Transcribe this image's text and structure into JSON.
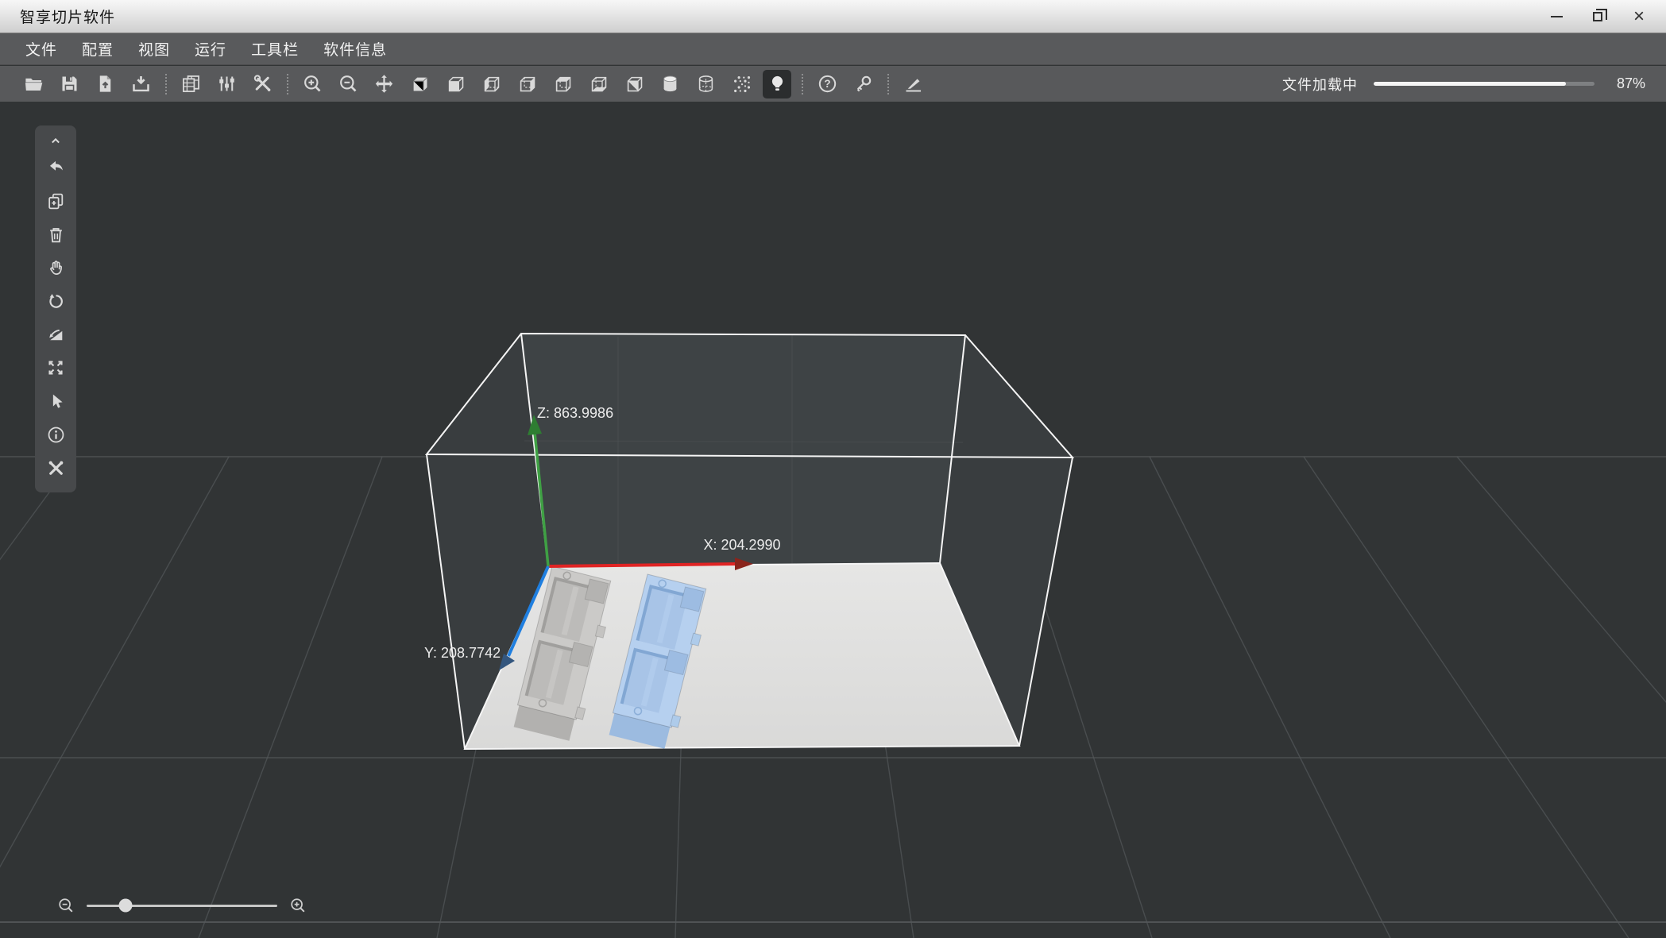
{
  "window": {
    "title": "智享切片软件",
    "controls": {
      "minimize": "minimize",
      "restore": "restore",
      "close": "×"
    }
  },
  "menu": {
    "items": [
      {
        "id": "file",
        "label": "文件"
      },
      {
        "id": "config",
        "label": "配置"
      },
      {
        "id": "view",
        "label": "视图"
      },
      {
        "id": "run",
        "label": "运行"
      },
      {
        "id": "toolbar",
        "label": "工具栏"
      },
      {
        "id": "about",
        "label": "软件信息"
      }
    ]
  },
  "toolbar": {
    "icons": [
      "open-folder",
      "save",
      "file-upload",
      "import",
      "parameter-table",
      "sliders",
      "tools",
      "zoom-in",
      "zoom-out",
      "move",
      "view-solid-cube",
      "view-front-face",
      "view-left-face",
      "view-right-face",
      "view-top-face",
      "view-bottom-face",
      "view-iso",
      "cylinder-solid",
      "cylinder-wireframe",
      "point-cloud",
      "light-toggle",
      "help",
      "key",
      "cut-knife"
    ],
    "active_icon": "light-toggle"
  },
  "progress": {
    "label": "文件加载中",
    "percent": 87,
    "percent_label": "87%"
  },
  "sidebar": {
    "icons": [
      "collapse-chevron",
      "undo",
      "duplicate",
      "delete",
      "pan",
      "rotate",
      "lay-flat",
      "scale-expand",
      "select-cursor",
      "info",
      "repair-tools"
    ]
  },
  "viewport": {
    "background_color": "#313435",
    "build_plate_color": "#e2e2e1",
    "axes": {
      "x": {
        "label": "X: 204.2990",
        "color": "#e02424",
        "arrow_color": "#8a241c"
      },
      "y": {
        "label": "Y: 208.7742",
        "color": "#1f7fe0",
        "arrow_color": "#33567e"
      },
      "z": {
        "label": "Z: 863.9986",
        "color": "#3fae44",
        "arrow_color": "#2e7d32"
      }
    },
    "models": [
      {
        "name": "tray-model-left",
        "color": "#cbcac8",
        "selected": false
      },
      {
        "name": "tray-model-right",
        "color": "#b6d0ef",
        "selected": true
      }
    ]
  },
  "zoom_control": {
    "value_percent": 20.5
  }
}
